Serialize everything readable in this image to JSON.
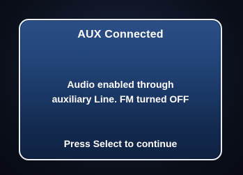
{
  "dialog": {
    "title": "AUX Connected",
    "message_lines": [
      "Audio enabled through",
      "auxiliary Line. FM turned OFF"
    ],
    "prompt": "Press Select to continue"
  },
  "colors": {
    "background": "#0b0f1a",
    "dialog_top": "#2b4f86",
    "dialog_bottom": "#0f2242",
    "border": "#e9eef7",
    "text": "#ffffff"
  }
}
